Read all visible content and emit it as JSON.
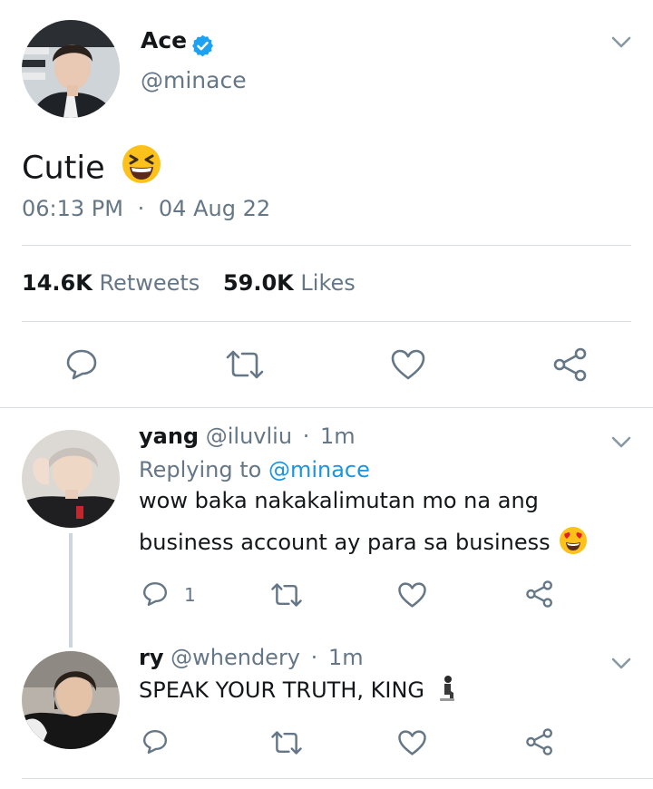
{
  "main_tweet": {
    "display_name": "Ace",
    "handle": "@minace",
    "verified_icon": "verified-badge-icon",
    "text": "Cutie",
    "emoji": "grinning-squinting-face",
    "time": "06:13 PM",
    "separator": "·",
    "date": "04 Aug 22",
    "retweets_count": "14.6K",
    "retweets_label": "Retweets",
    "likes_count": "59.0K",
    "likes_label": "Likes",
    "actions": [
      "reply-icon",
      "retweet-icon",
      "like-icon",
      "share-icon"
    ]
  },
  "replies": [
    {
      "display_name": "yang",
      "handle": "@iluvliu",
      "separator": "·",
      "time": "1m",
      "replying_prefix": "Replying to",
      "replying_to": "@minace",
      "text_line1": "wow baka nakakalimutan mo na ang",
      "text_line2": "business account ay para sa business",
      "emoji": "heart-eyes-face",
      "reply_count": "1"
    },
    {
      "display_name": "ry",
      "handle": "@whendery",
      "separator": "·",
      "time": "1m",
      "text": "SPEAK YOUR TRUTH, KING",
      "emoji": "person-kneeling"
    }
  ],
  "colors": {
    "text": "#14171a",
    "secondary": "#657786",
    "link": "#1b95e0",
    "divider": "#d5dde3",
    "verified": "#1da1f2"
  }
}
